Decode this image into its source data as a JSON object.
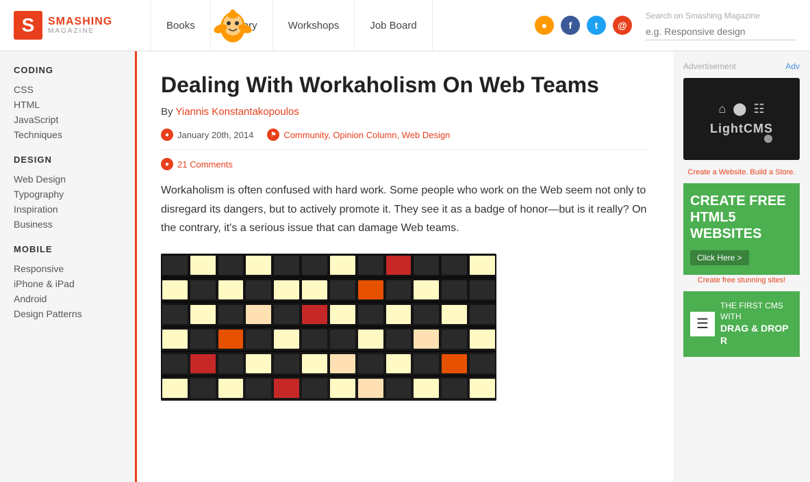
{
  "header": {
    "logo": {
      "letter": "S",
      "brand": "SMASHING",
      "sub": "MAGAZINE"
    },
    "nav": [
      {
        "id": "books",
        "label": "Books"
      },
      {
        "id": "library",
        "label": "Library"
      },
      {
        "id": "workshops",
        "label": "Workshops"
      },
      {
        "id": "jobboard",
        "label": "Job Board"
      }
    ],
    "search": {
      "label": "Search on Smashing Magazine",
      "placeholder": "e.g. Responsive design"
    }
  },
  "sidebar": {
    "sections": [
      {
        "id": "coding",
        "title": "CODING",
        "links": [
          "CSS",
          "HTML",
          "JavaScript",
          "Techniques"
        ]
      },
      {
        "id": "design",
        "title": "DESIGN",
        "links": [
          "Web Design",
          "Typography",
          "Inspiration",
          "Business"
        ]
      },
      {
        "id": "mobile",
        "title": "MOBILE",
        "links": [
          "Responsive",
          "iPhone & iPad",
          "Android",
          "Design Patterns"
        ]
      }
    ]
  },
  "article": {
    "title": "Dealing With Workaholism On Web Teams",
    "author_prefix": "By",
    "author_name": "Yiannis Konstantakopoulos",
    "date": "January 20th, 2014",
    "tags": "Community, Opinion Column, Web Design",
    "comments": "21 Comments",
    "intro": "Workaholism is often confused with hard work. Some people who work on the Web seem not only to disregard its dangers, but to actively promote it. They see it as a badge of honor—but is it really? On the contrary, it's a serious issue that can damage Web teams."
  },
  "ads": {
    "label": "Advertisement",
    "label_short": "Adv",
    "ad1_name": "LightCMS",
    "ad1_link": "Create a Website. Build a Store.",
    "ad2_title": "CREATE FREE HTML5 WEBSITES",
    "ad2_btn": "Click Here >",
    "ad2_link": "Create free stunning sites!",
    "ad3_prefix": "THE FIRST CMS WITH",
    "ad3_title": "DRAG & DROP R"
  }
}
